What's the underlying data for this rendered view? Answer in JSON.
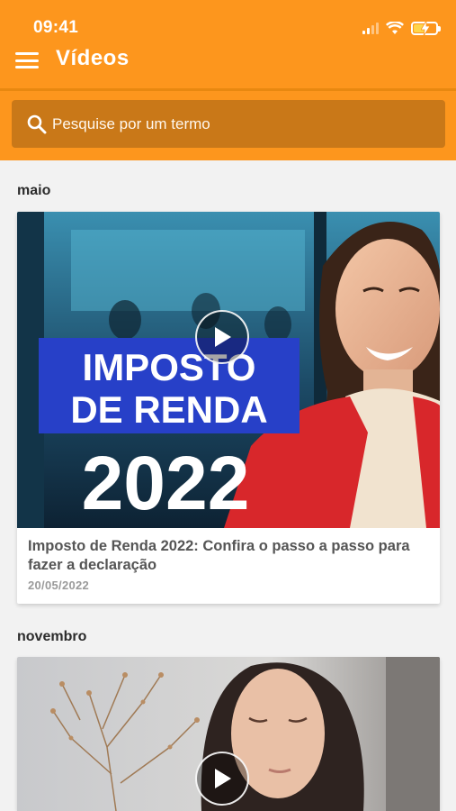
{
  "status_bar": {
    "time": "09:41"
  },
  "header": {
    "title": "Vídeos"
  },
  "search": {
    "placeholder": "Pesquise por um termo"
  },
  "sections": [
    {
      "label": "maio",
      "video": {
        "thumbnail_text_line1": "IMPOSTO",
        "thumbnail_text_line2": "DE RENDA",
        "thumbnail_year": "2022",
        "title": "Imposto de Renda 2022: Confira o passo a passo para fazer a declaração",
        "date": "20/05/2022"
      }
    },
    {
      "label": "novembro",
      "video": {}
    }
  ],
  "icons": {
    "menu": "hamburger-menu-icon",
    "search": "search-icon",
    "play": "play-icon",
    "signal": "cellular-signal-icon",
    "wifi": "wifi-icon",
    "battery": "battery-charging-icon"
  },
  "colors": {
    "header": "#fd961d",
    "search_bg": "#c97818",
    "thumbnail_banner": "#2740c8",
    "jacket_red": "#d8272b"
  }
}
